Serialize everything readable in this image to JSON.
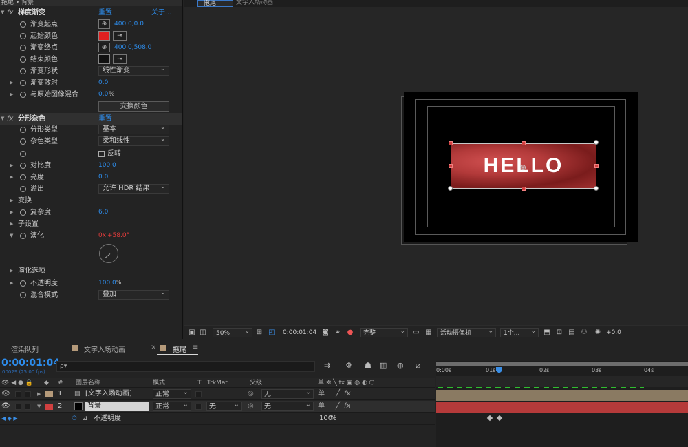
{
  "fx_panel": {
    "header": "拖尾 • 背景",
    "gradient": {
      "name": "梯度渐变",
      "reset": "重置",
      "about": "关于...",
      "start_point_label": "渐变起点",
      "start_point_value": "400.0,0.0",
      "start_color_label": "起始颜色",
      "start_color": "#e02020",
      "end_point_label": "渐变终点",
      "end_point_value": "400.0,508.0",
      "end_color_label": "结束颜色",
      "end_color": "#111111",
      "shape_label": "渐变形状",
      "shape_value": "线性渐变",
      "scatter_label": "渐变散射",
      "scatter_value": "0.0",
      "blend_label": "与原始图像混合",
      "blend_value": "0.0",
      "blend_unit": "%",
      "swap_button": "交换颜色"
    },
    "fractal": {
      "name": "分形杂色",
      "reset": "重置",
      "type_label": "分形类型",
      "type_value": "基本",
      "noise_label": "杂色类型",
      "noise_value": "柔和线性",
      "invert_label": "反转",
      "contrast_label": "对比度",
      "contrast_value": "100.0",
      "brightness_label": "亮度",
      "brightness_value": "0.0",
      "overflow_label": "溢出",
      "overflow_value": "允许 HDR 结果",
      "transform_label": "变换",
      "complexity_label": "复杂度",
      "complexity_value": "6.0",
      "sub_label": "子设置",
      "evolution_label": "演化",
      "evolution_rev": "0x",
      "evolution_deg": "+58.0°",
      "evolution_opts_label": "演化选项",
      "opacity_label": "不透明度",
      "opacity_value": "100.0",
      "opacity_unit": "%",
      "blend_mode_label": "混合模式",
      "blend_mode_value": "叠加"
    }
  },
  "viewer": {
    "tab_active": "拖尾",
    "tab_other": "文字入场动画",
    "hello_text": "HELLO",
    "zoom": "50%",
    "timecode": "0:00:01:04",
    "resolution": "完整",
    "camera": "活动摄像机",
    "views": "1个...",
    "exposure": "+0.0"
  },
  "timeline": {
    "tab_render": "渲染队列",
    "tab_text_anim": "文字入场动画",
    "tab_active": "拖尾",
    "timecode": "0:00:01:04",
    "frames": "00029 (25.00 fps)",
    "search_placeholder": "ρ▾",
    "col_num": "#",
    "col_name": "图层名称",
    "col_mode": "模式",
    "col_t": "T",
    "col_trkmat": "TrkMat",
    "col_parent": "父级",
    "layers": [
      {
        "num": "1",
        "name": "[文字入场动画]",
        "mode": "正常",
        "trkmat": "",
        "parent": "无",
        "color": "#b59a7a"
      },
      {
        "num": "2",
        "name": "背景",
        "mode": "正常",
        "trkmat": "无",
        "parent": "无",
        "color": "#d04040"
      }
    ],
    "prop_label": "不透明度",
    "prop_value": "100",
    "prop_unit": "%",
    "ticks": [
      "0:00s",
      "01s",
      "02s",
      "03s",
      "04s"
    ]
  }
}
